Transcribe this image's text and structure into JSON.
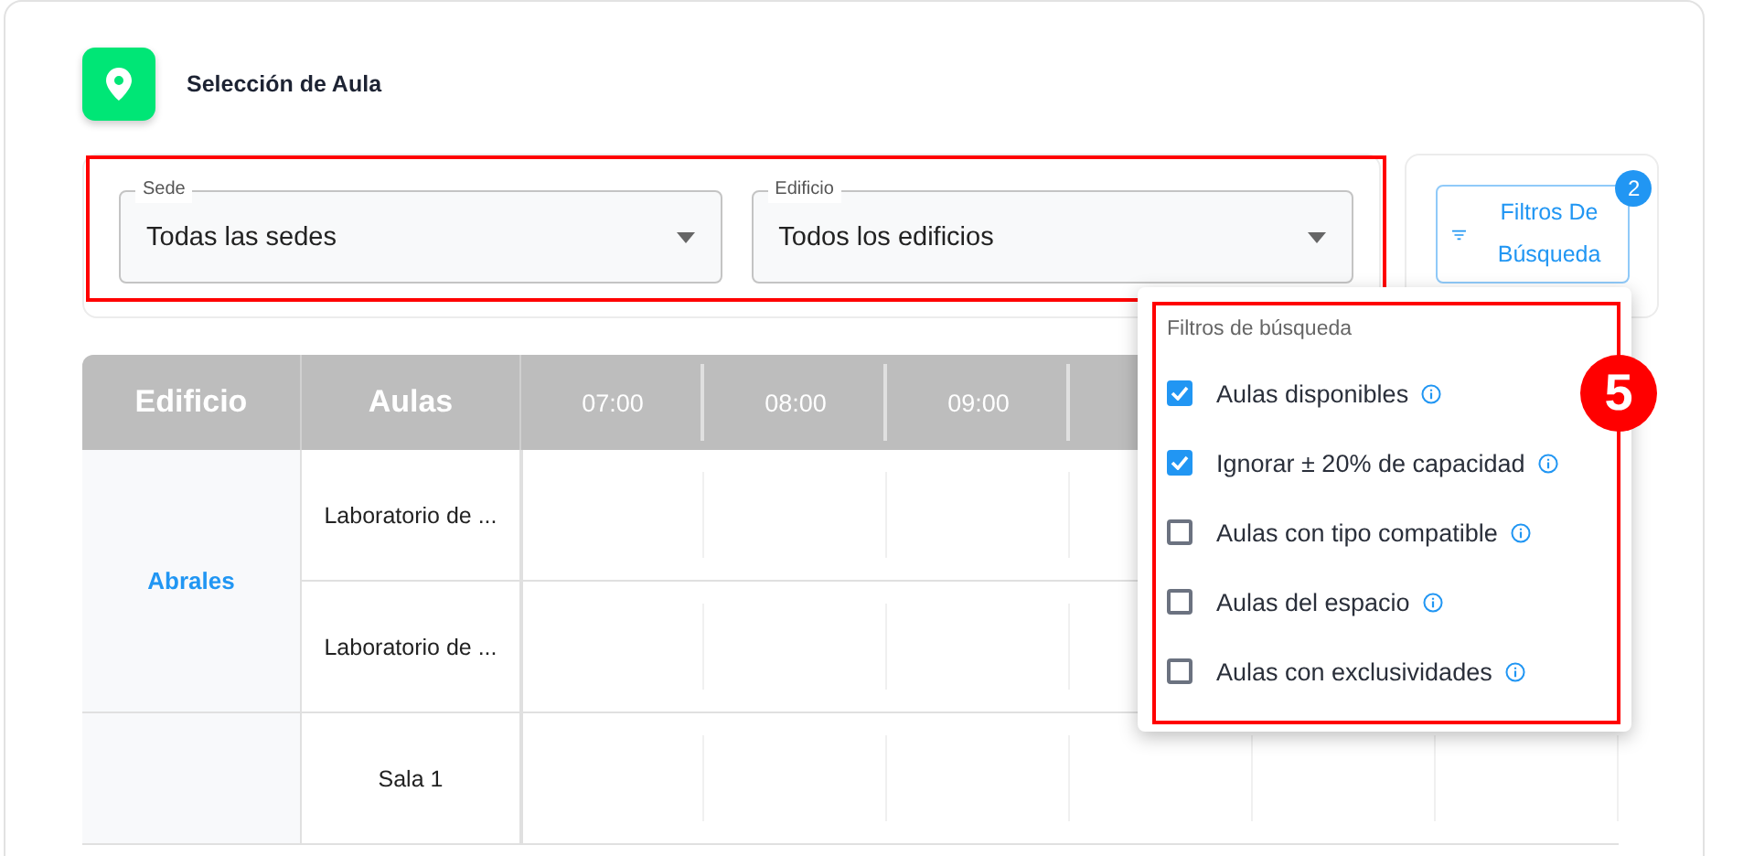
{
  "header": {
    "title": "Selección de Aula"
  },
  "filters": [
    {
      "label": "Sede",
      "value": "Todas las sedes"
    },
    {
      "label": "Edificio",
      "value": "Todos los edificios"
    }
  ],
  "filter_button": {
    "label": "Filtros De Búsqueda",
    "badge": "2"
  },
  "table": {
    "columns": [
      "Edificio",
      "Aulas"
    ],
    "time_columns": [
      "07:00",
      "08:00",
      "09:00"
    ],
    "groups": [
      {
        "building": "Abrales",
        "rooms": [
          "Laboratorio de ...",
          "Laboratorio de ..."
        ]
      },
      {
        "rooms": [
          "Sala 1"
        ]
      }
    ]
  },
  "popup": {
    "title": "Filtros de búsqueda",
    "options": [
      {
        "label": "Aulas disponibles",
        "checked": true
      },
      {
        "label": "Ignorar ± 20% de capacidad",
        "checked": true
      },
      {
        "label": "Aulas con tipo compatible",
        "checked": false
      },
      {
        "label": "Aulas del espacio",
        "checked": false
      },
      {
        "label": "Aulas con exclusividades",
        "checked": false
      }
    ]
  },
  "step_marker": "5"
}
